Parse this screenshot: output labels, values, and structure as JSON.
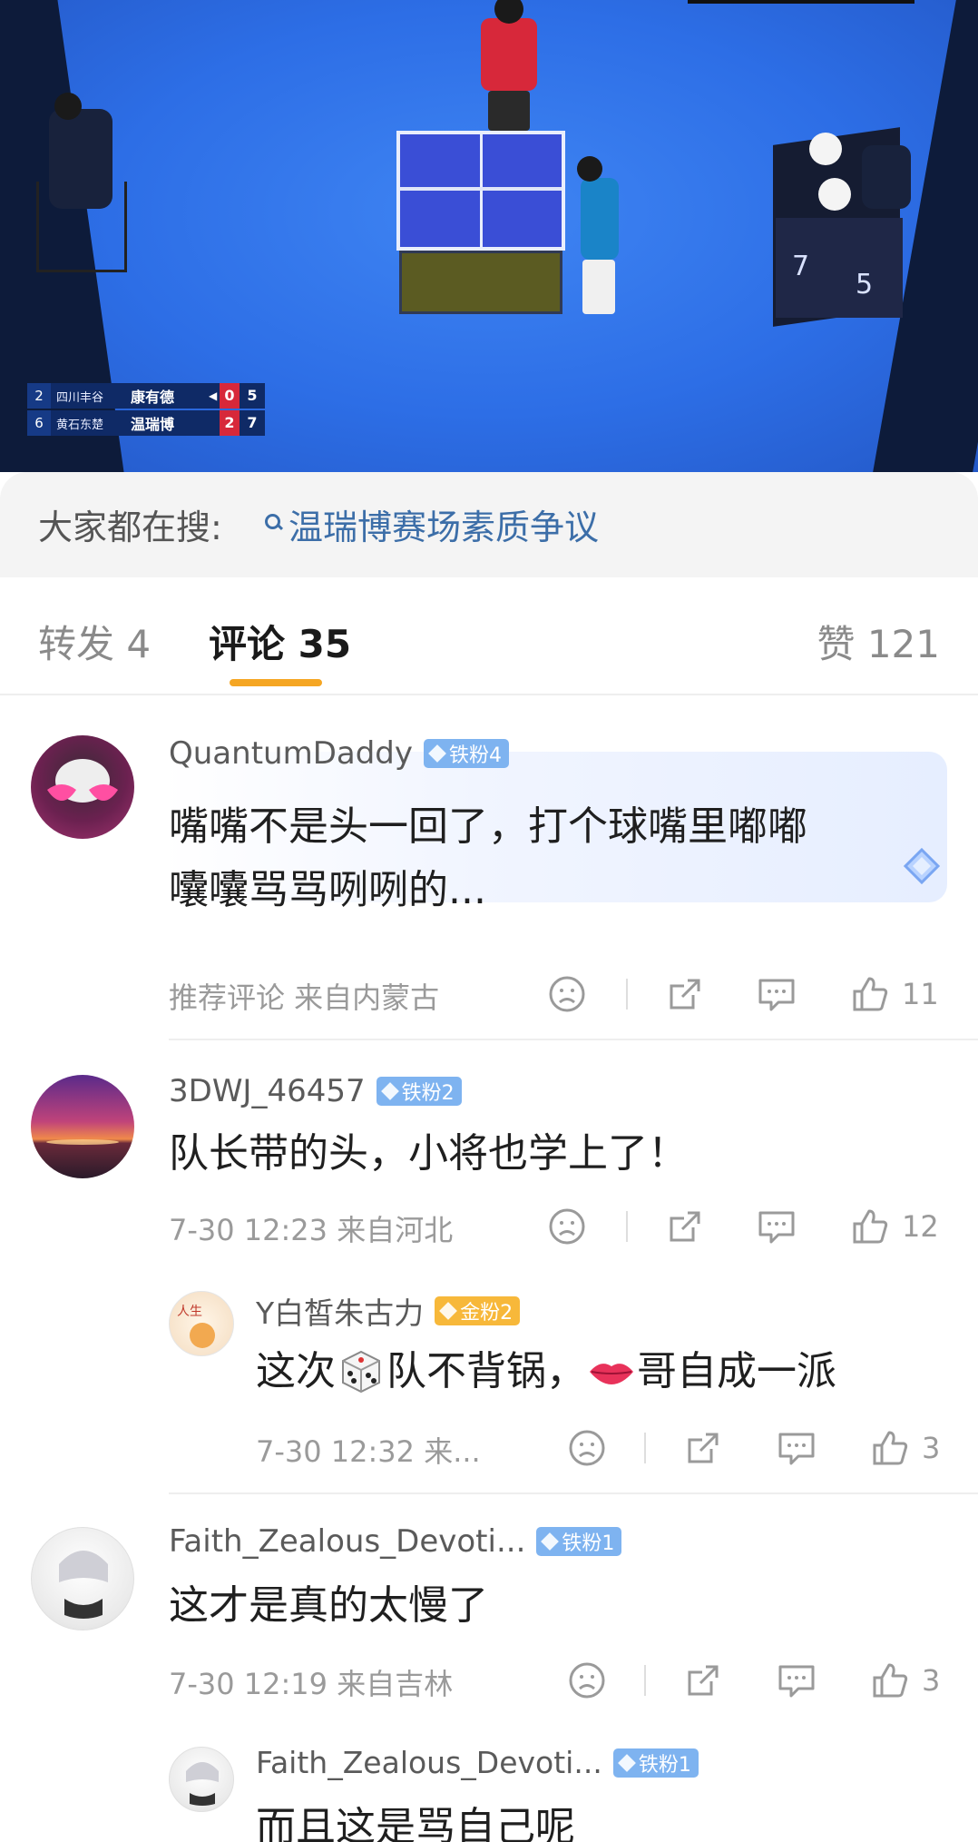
{
  "scoreboard": {
    "row1": {
      "seed": "2",
      "team": "四川丰谷",
      "name": "康有德",
      "games": "0",
      "points": "5"
    },
    "row2": {
      "seed": "6",
      "team": "黄石东楚",
      "name": "温瑞博",
      "games": "2",
      "points": "7"
    },
    "venue_board": {
      "left": "7",
      "right": "5"
    }
  },
  "search": {
    "label": "大家都在搜:",
    "query": "温瑞博赛场素质争议"
  },
  "tabs": {
    "repost": "转发 4",
    "comment": "评论 35",
    "like": "赞 121"
  },
  "comments": [
    {
      "username": "QuantumDaddy",
      "badge": "铁粉4",
      "text_line1": "嘴嘴不是头一回了，打个球嘴里嘟嘟",
      "text_line2": "囔囔骂骂咧咧的...",
      "meta": "推荐评论  来自内蒙古",
      "likes": "11"
    },
    {
      "username": "3DWJ_46457",
      "badge": "铁粉2",
      "text": "队长带的头，小将也学上了！",
      "meta": "7-30 12:23  来自河北",
      "likes": "12"
    },
    {
      "username": "Y白皙朱古力",
      "badge": "金粉2",
      "text_a": "这次",
      "text_b": "队不背锅，",
      "text_c": "哥自成一派",
      "meta": "7-30 12:32  来...",
      "likes": "3"
    },
    {
      "username": "Faith_Zealous_Devoti...",
      "badge": "铁粉1",
      "text": "这才是真的太慢了",
      "meta": "7-30 12:19  来自吉林",
      "likes": "3"
    },
    {
      "username": "Faith_Zealous_Devoti...",
      "badge": "铁粉1",
      "text": "而且这是骂自己呢"
    }
  ],
  "colors": {
    "accent_underline": "#f5a623",
    "search_link": "#3c6ea8",
    "fan_badge": "#7eb3f0",
    "gold_badge": "#f7b83a"
  }
}
